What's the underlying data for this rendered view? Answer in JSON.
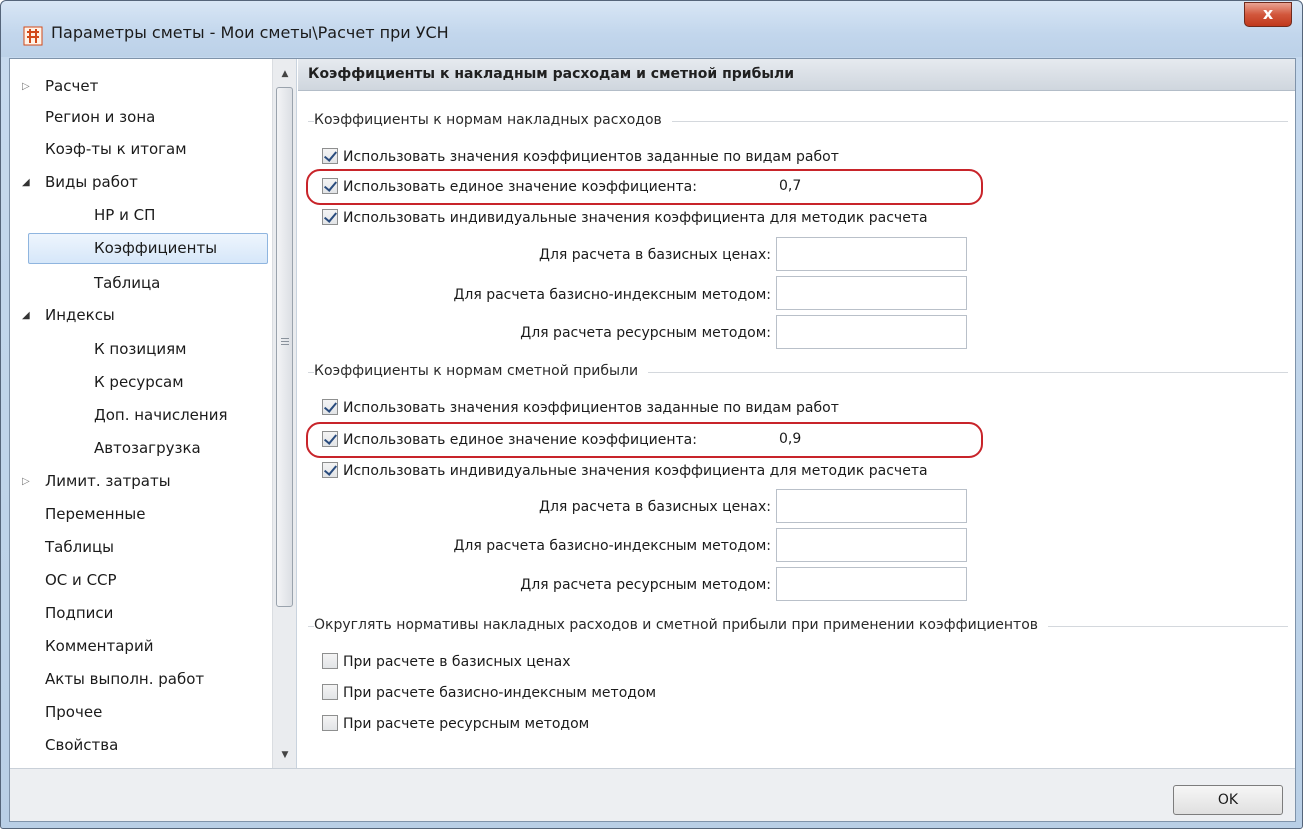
{
  "window": {
    "title": "Параметры сметы - Мои сметы\\Расчет при УСН",
    "close_label": "x"
  },
  "sidebar": {
    "items": [
      {
        "label": "Расчет"
      },
      {
        "label": "Регион и зона"
      },
      {
        "label": "Коэф-ты к итогам"
      },
      {
        "label": "Виды работ"
      },
      {
        "label": "НР и СП"
      },
      {
        "label": "Коэффициенты"
      },
      {
        "label": "Таблица"
      },
      {
        "label": "Индексы"
      },
      {
        "label": "К позициям"
      },
      {
        "label": "К ресурсам"
      },
      {
        "label": "Доп. начисления"
      },
      {
        "label": "Автозагрузка"
      },
      {
        "label": "Лимит. затраты"
      },
      {
        "label": "Переменные"
      },
      {
        "label": "Таблицы"
      },
      {
        "label": "ОС и ССР"
      },
      {
        "label": "Подписи"
      },
      {
        "label": "Комментарий"
      },
      {
        "label": "Акты выполн. работ"
      },
      {
        "label": "Прочее"
      },
      {
        "label": "Свойства"
      }
    ],
    "selected": "Коэффициенты"
  },
  "content": {
    "header": "Коэффициенты к накладным расходам и сметной прибыли",
    "overhead": {
      "group_title": "Коэффициенты к нормам накладных расходов",
      "cb_by_work_type": "Использовать значения коэффициентов заданные по видам работ",
      "cb_single_value": "Использовать единое значение коэффициента:",
      "single_value": "0,7",
      "cb_individual": "Использовать индивидуальные значения коэффициента для методик расчета",
      "label_base": "Для расчета в базисных ценах:",
      "label_base_index": "Для расчета базисно-индексным методом:",
      "label_resource": "Для расчета ресурсным методом:",
      "value_base": "",
      "value_base_index": "",
      "value_resource": ""
    },
    "profit": {
      "group_title": "Коэффициенты к нормам сметной прибыли",
      "cb_by_work_type": "Использовать значения коэффициентов заданные по видам работ",
      "cb_single_value": "Использовать единое значение коэффициента:",
      "single_value": "0,9",
      "cb_individual": "Использовать индивидуальные значения коэффициента для методик расчета",
      "label_base": "Для расчета в базисных ценах:",
      "label_base_index": "Для расчета базисно-индексным методом:",
      "label_resource": "Для расчета ресурсным методом:",
      "value_base": "",
      "value_base_index": "",
      "value_resource": ""
    },
    "rounding": {
      "group_title": "Округлять нормативы накладных расходов и сметной прибыли при применении коэффициентов",
      "cb_base": "При расчете в базисных ценах",
      "cb_base_index": "При расчете базисно-индексным методом",
      "cb_resource": "При расчете ресурсным методом"
    }
  },
  "footer": {
    "ok_label": "OK"
  },
  "colors": {
    "highlight": "#c8242a",
    "title_bar": "#c2d6ec",
    "close_button": "#d2573c"
  }
}
